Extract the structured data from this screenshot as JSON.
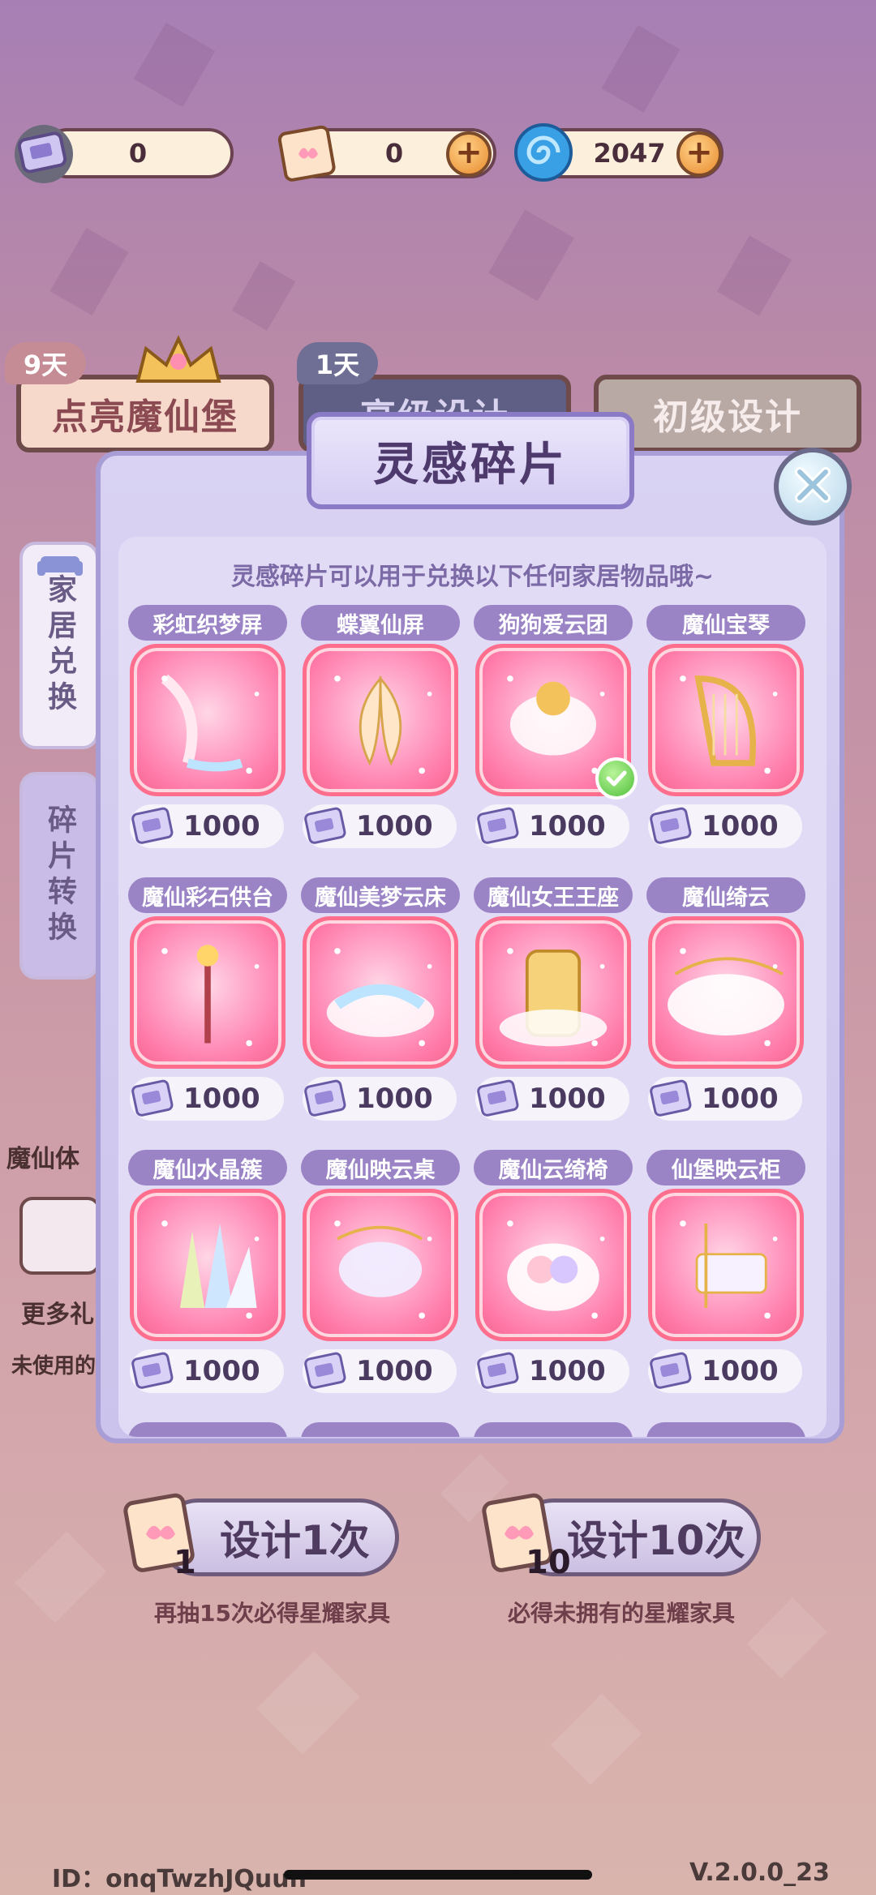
{
  "currencies": [
    {
      "name": "design-ticket",
      "value": "0"
    },
    {
      "name": "butterfly-scroll",
      "value": "0"
    },
    {
      "name": "swirl-coin",
      "value": "2047"
    }
  ],
  "background_tabs": {
    "light_castle": "点亮魔仙堡",
    "light_castle_days": "9天",
    "advanced_days": "1天",
    "advanced": "高级设计",
    "basic": "初级设计"
  },
  "side_tabs": {
    "home_exchange": "家居兑换",
    "fragment_convert": "碎片转换"
  },
  "behind_labels": {
    "experience": "魔仙体",
    "more": "更多礼",
    "unused": "未使用的"
  },
  "modal": {
    "title": "灵感碎片",
    "hint": "灵感碎片可以用于兑换以下任何家居物品哦~",
    "items": [
      {
        "name": "彩虹织梦屏",
        "price": "1000",
        "owned": false
      },
      {
        "name": "蝶翼仙屏",
        "price": "1000",
        "owned": false
      },
      {
        "name": "狗狗爱云团",
        "price": "1000",
        "owned": true
      },
      {
        "name": "魔仙宝琴",
        "price": "1000",
        "owned": false
      },
      {
        "name": "魔仙彩石供台",
        "price": "1000",
        "owned": false
      },
      {
        "name": "魔仙美梦云床",
        "price": "1000",
        "owned": false
      },
      {
        "name": "魔仙女王王座",
        "price": "1000",
        "owned": false
      },
      {
        "name": "魔仙绮云",
        "price": "1000",
        "owned": false
      },
      {
        "name": "魔仙水晶簇",
        "price": "1000",
        "owned": false
      },
      {
        "name": "魔仙映云桌",
        "price": "1000",
        "owned": false
      },
      {
        "name": "魔仙云绮椅",
        "price": "1000",
        "owned": false
      },
      {
        "name": "仙堡映云柜",
        "price": "1000",
        "owned": false
      }
    ]
  },
  "draw": {
    "once_label": "设计1次",
    "once_count": "1",
    "once_note": "再抽15次必得星耀家具",
    "ten_label": "设计10次",
    "ten_count": "10",
    "ten_note": "必得未拥有的星耀家具"
  },
  "footer": {
    "id": "ID：onqTwzhJQuun",
    "version": "V.2.0.0_23"
  },
  "colors": {
    "accent": "#9b84c6",
    "item_border": "#ff6f8d",
    "check": "#4fbf3a"
  }
}
